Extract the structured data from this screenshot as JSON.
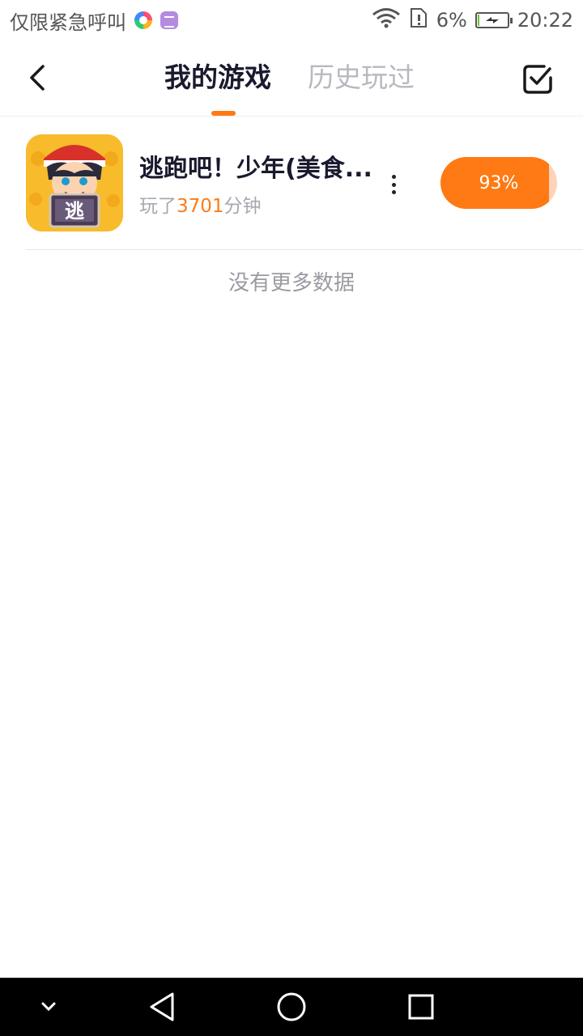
{
  "status_bar": {
    "carrier_text": "仅限紧急呼叫",
    "battery_percent": "6%",
    "battery_level": 0.06,
    "time": "20:22",
    "icons": [
      "app-multicolor-icon",
      "app-purple-icon",
      "wifi-icon",
      "sim-alert-icon",
      "battery-charging-icon"
    ]
  },
  "header": {
    "tabs": [
      {
        "label": "我的游戏",
        "active": true
      },
      {
        "label": "历史玩过",
        "active": false
      }
    ],
    "back_icon": "chevron-left-icon",
    "edit_icon": "checkbox-icon"
  },
  "games": [
    {
      "title": "逃跑吧！少年(美食...",
      "played_prefix": "玩了",
      "minutes": "3701",
      "played_suffix": "分钟",
      "progress_label": "93%",
      "progress": 0.93,
      "icon_text": "逃"
    }
  ],
  "list_footer": "没有更多数据",
  "colors": {
    "accent": "#ff7a14",
    "title": "#1a1a2e",
    "muted": "#a8a8b0"
  },
  "nav_bar": {
    "icons": [
      "chevron-down-icon",
      "back-triangle-icon",
      "home-circle-icon",
      "recents-square-icon"
    ]
  }
}
